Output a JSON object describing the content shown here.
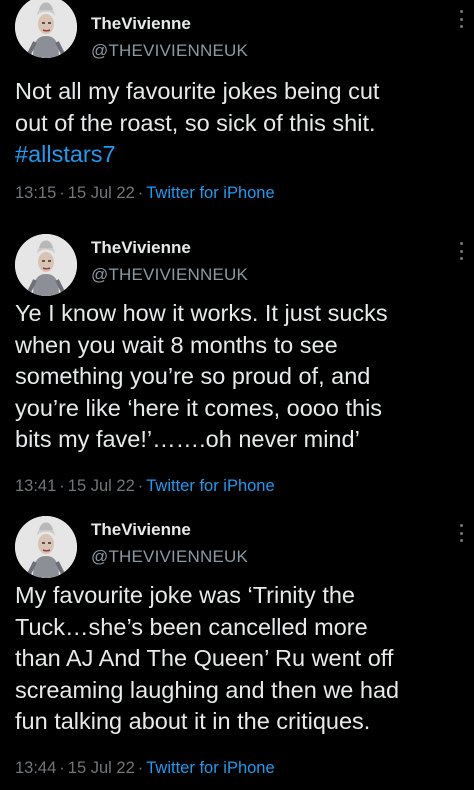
{
  "colors": {
    "background": "#000000",
    "text": "#e7e9ea",
    "secondary": "#71767b",
    "link": "#1d9bf0"
  },
  "tweets": [
    {
      "display_name": "TheVivienne",
      "handle": "@THEVIVIENNEUK",
      "lines": [
        "Not all my favourite jokes being cut",
        "out of the roast, so sick of this shit."
      ],
      "hashtag": "#allstars7",
      "time": "13:15",
      "date": "15 Jul 22",
      "source": "Twitter for iPhone",
      "menu_icon": "more-vertical-icon",
      "avatar_icon": "profile-photo"
    },
    {
      "display_name": "TheVivienne",
      "handle": "@THEVIVIENNEUK",
      "lines": [
        "Ye I know how it works. It just sucks",
        "when you wait 8 months to see",
        "something you’re so proud of, and",
        "you’re  like ‘here it comes, oooo this",
        "bits my fave!’…….oh never mind’"
      ],
      "time": "13:41",
      "date": "15 Jul 22",
      "source": "Twitter for iPhone",
      "menu_icon": "more-vertical-icon",
      "avatar_icon": "profile-photo"
    },
    {
      "display_name": "TheVivienne",
      "handle": "@THEVIVIENNEUK",
      "lines": [
        "My favourite joke was ‘Trinity the",
        "Tuck…she’s been cancelled more",
        "than AJ And The Queen’ Ru went off",
        "screaming laughing and then we had",
        "fun talking about it in the critiques."
      ],
      "time": "13:44",
      "date": "15 Jul 22",
      "source": "Twitter for iPhone",
      "menu_icon": "more-vertical-icon",
      "avatar_icon": "profile-photo"
    }
  ],
  "separator": "·"
}
